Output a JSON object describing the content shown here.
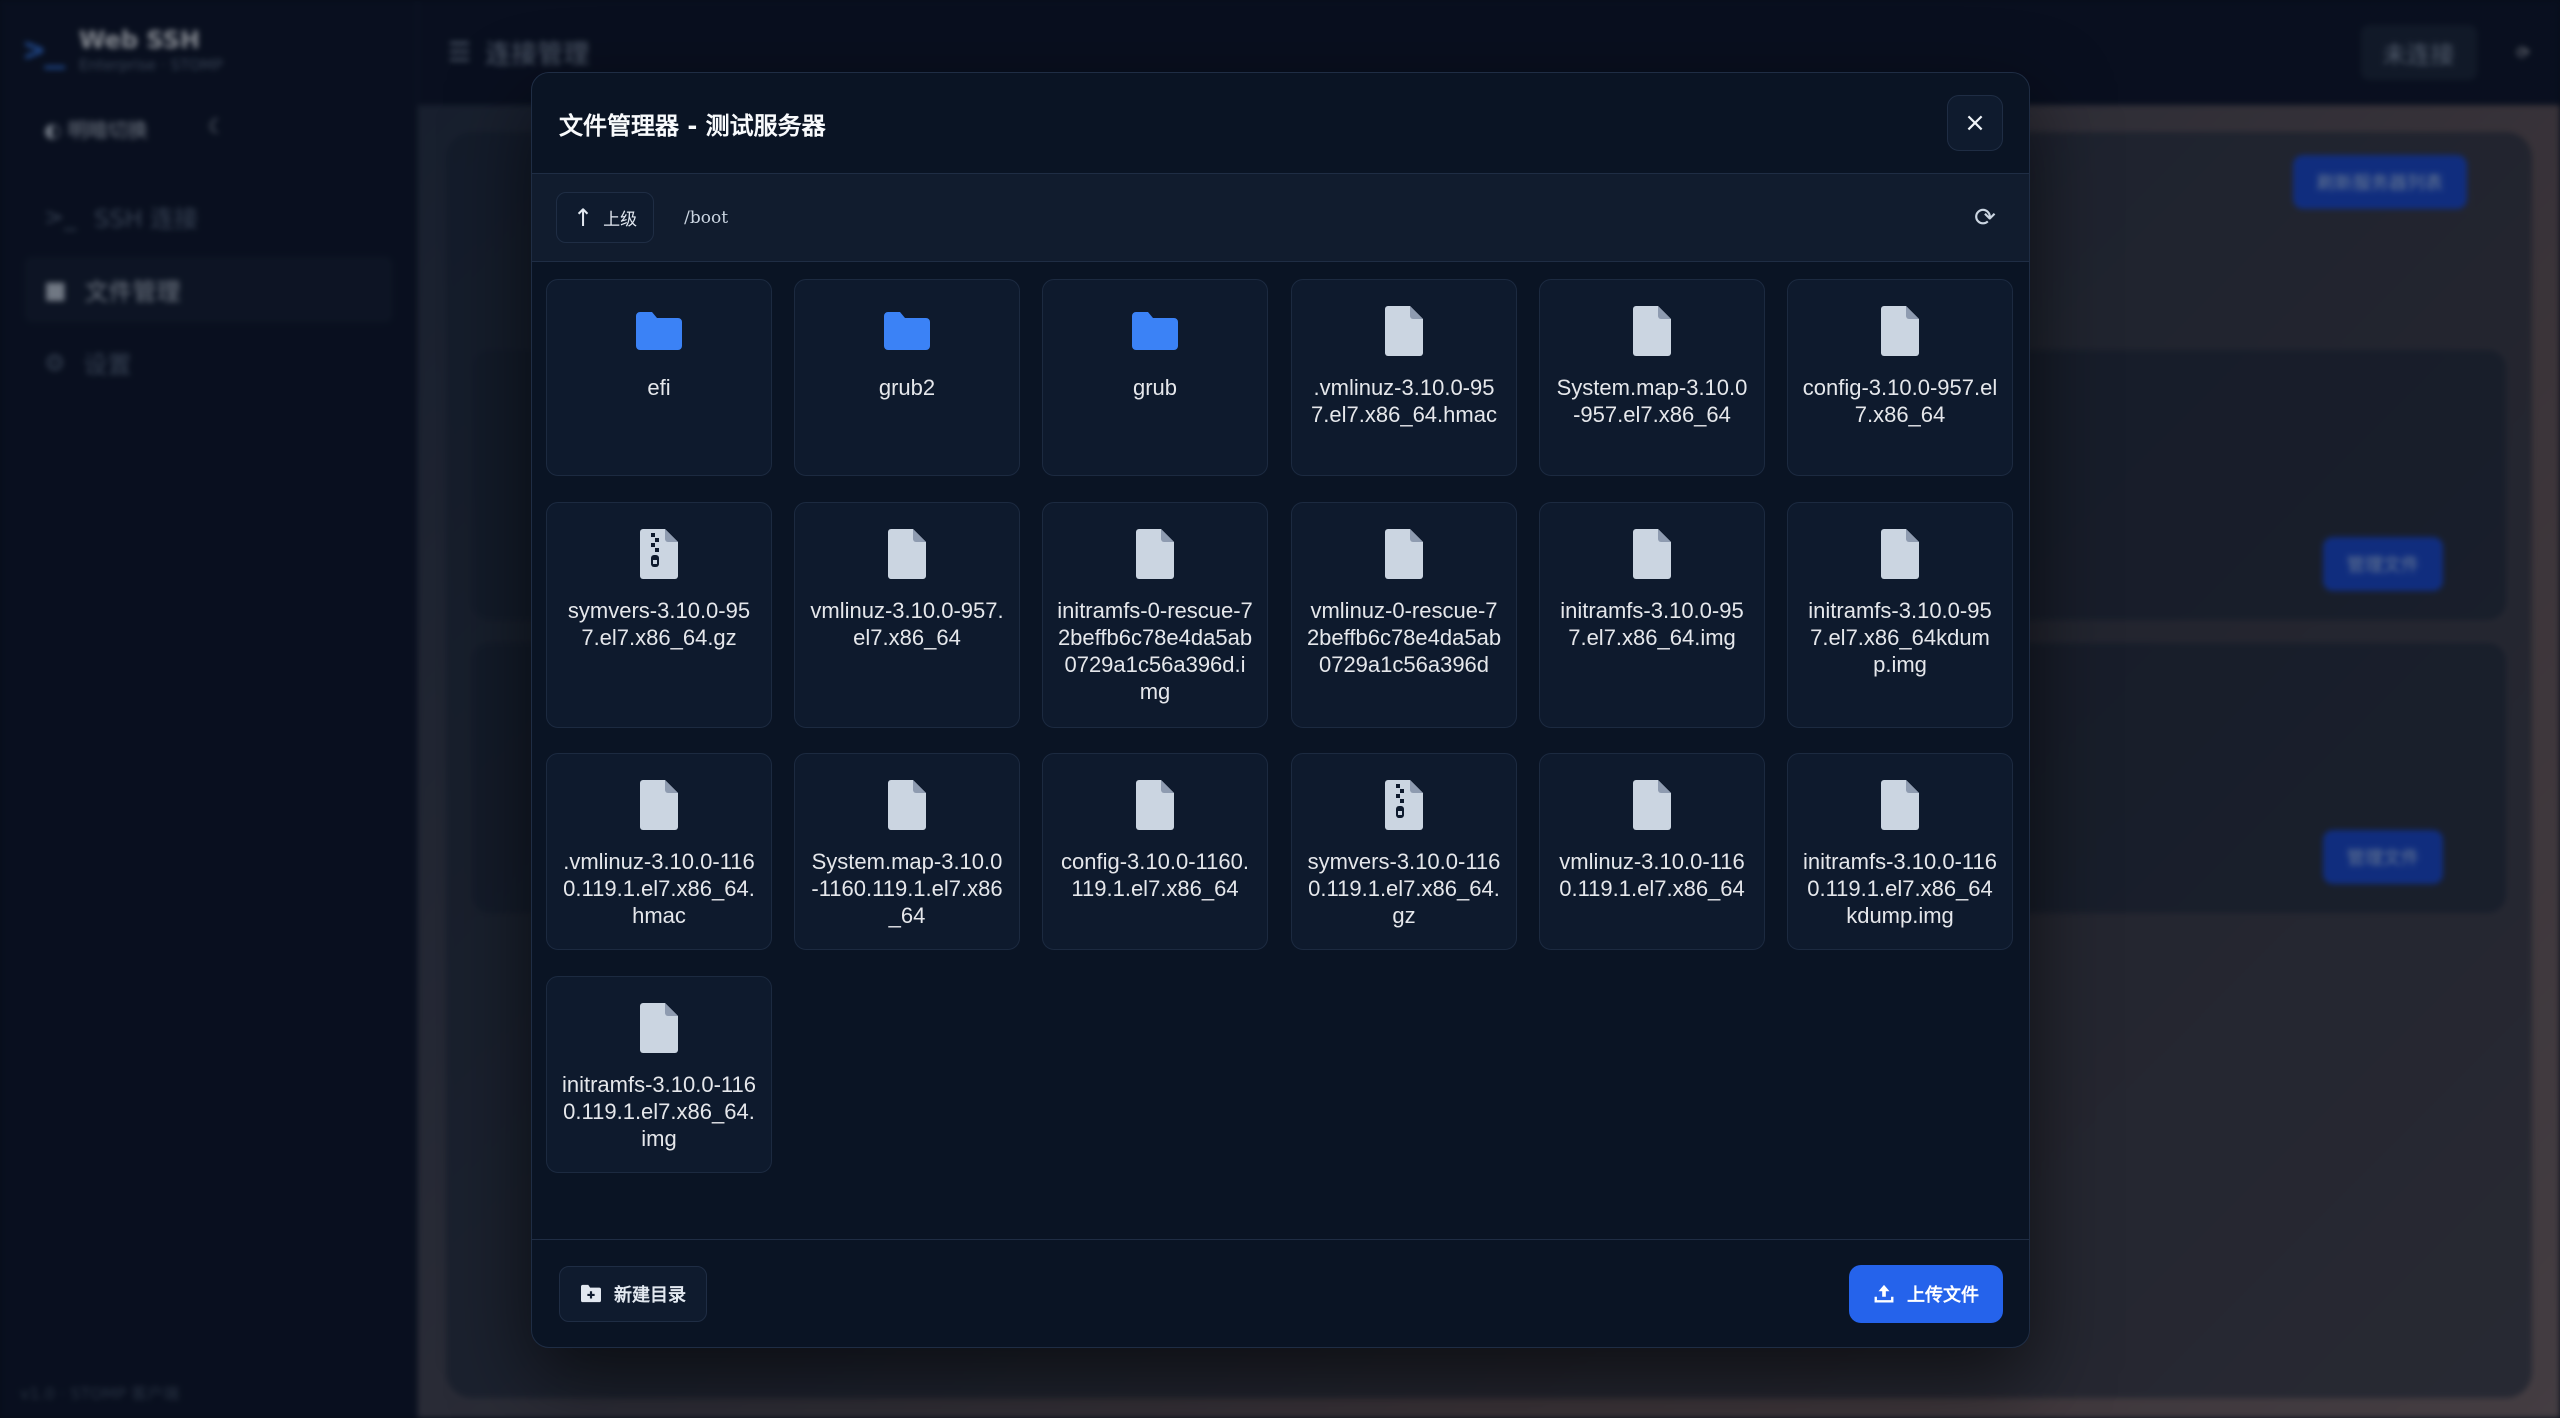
{
  "app": {
    "brand_title": "Web SSH",
    "brand_subtitle": "Enterprise · STOMP",
    "theme_label": "◐ 明暗切换",
    "nav": [
      {
        "label": "SSH 连接"
      },
      {
        "label": "文件管理"
      },
      {
        "label": "设置"
      }
    ],
    "version": "v1.0 · STOMP 客户端",
    "topbar_title": "连接管理",
    "topbar_status": "未连接",
    "bg_buttons": [
      "刷新服务器列表",
      "管理文件",
      "管理文件"
    ]
  },
  "modal": {
    "title": "文件管理器 - 测试服务器",
    "close_label": "×",
    "up_label": "上级",
    "path": "/boot",
    "new_dir_label": "新建目录",
    "upload_label": "上传文件"
  },
  "colors": {
    "folder": "#3b82f6",
    "file": "#cbd5e1",
    "accent": "#2563eb"
  },
  "files": [
    {
      "name": "efi",
      "type": "folder-icon"
    },
    {
      "name": "grub2",
      "type": "folder-icon"
    },
    {
      "name": "grub",
      "type": "folder-icon"
    },
    {
      "name": ".vmlinuz-3.10.0-957.el7.x86_64.hmac",
      "type": "file-icon"
    },
    {
      "name": "System.map-3.10.0-957.el7.x86_64",
      "type": "file-icon"
    },
    {
      "name": "config-3.10.0-957.el7.x86_64",
      "type": "file-icon"
    },
    {
      "name": "symvers-3.10.0-957.el7.x86_64.gz",
      "type": "archive-file-icon"
    },
    {
      "name": "vmlinuz-3.10.0-957.el7.x86_64",
      "type": "file-icon"
    },
    {
      "name": "initramfs-0-rescue-72beffb6c78e4da5ab0729a1c56a396d.img",
      "type": "file-icon"
    },
    {
      "name": "vmlinuz-0-rescue-72beffb6c78e4da5ab0729a1c56a396d",
      "type": "file-icon"
    },
    {
      "name": "initramfs-3.10.0-957.el7.x86_64.img",
      "type": "file-icon"
    },
    {
      "name": "initramfs-3.10.0-957.el7.x86_64kdump.img",
      "type": "file-icon"
    },
    {
      "name": ".vmlinuz-3.10.0-1160.119.1.el7.x86_64.hmac",
      "type": "file-icon"
    },
    {
      "name": "System.map-3.10.0-1160.119.1.el7.x86_64",
      "type": "file-icon"
    },
    {
      "name": "config-3.10.0-1160.119.1.el7.x86_64",
      "type": "file-icon"
    },
    {
      "name": "symvers-3.10.0-1160.119.1.el7.x86_64.gz",
      "type": "archive-file-icon"
    },
    {
      "name": "vmlinuz-3.10.0-1160.119.1.el7.x86_64",
      "type": "file-icon"
    },
    {
      "name": "initramfs-3.10.0-1160.119.1.el7.x86_64kdump.img",
      "type": "file-icon"
    },
    {
      "name": "initramfs-3.10.0-1160.119.1.el7.x86_64.img",
      "type": "file-icon"
    }
  ]
}
